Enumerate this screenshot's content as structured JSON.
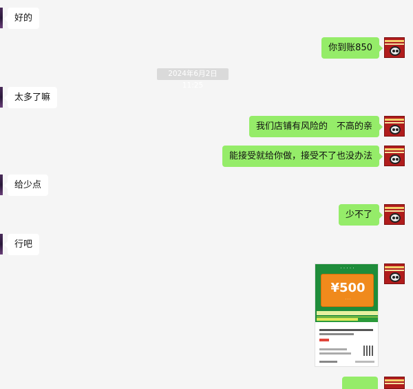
{
  "messages": {
    "m1": "好的",
    "m2": "你到账850",
    "timestamp": "2024年6月2日 11:25",
    "m3": "太多了嘛",
    "m4": "我们店铺有风险的　不高的亲",
    "m5": "能接受就给你做，接受不了也没办法",
    "m6": "给少点",
    "m7": "少不了",
    "m8": "行吧"
  },
  "image_message": {
    "voucher_amount": "¥500"
  },
  "colors": {
    "background": "#f5f5f5",
    "incoming_bubble": "#ffffff",
    "outgoing_bubble": "#95ec69",
    "timestamp_bg": "#dadada"
  }
}
